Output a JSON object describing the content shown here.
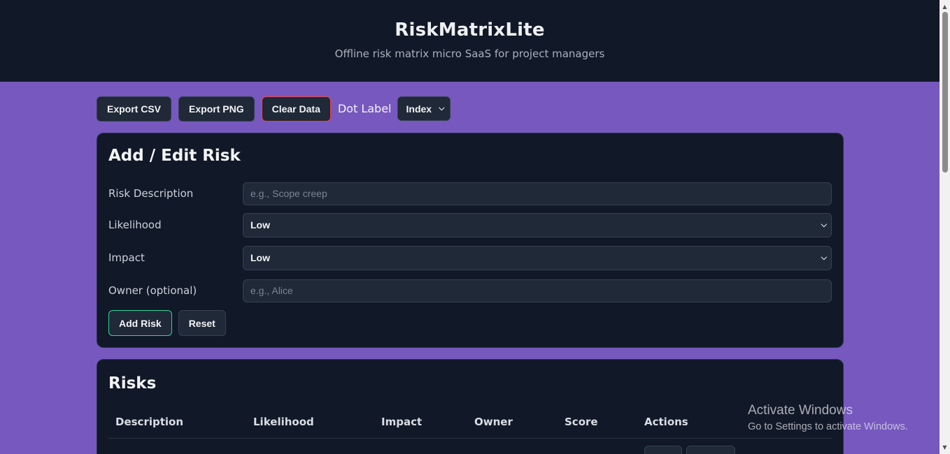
{
  "header": {
    "title": "RiskMatrixLite",
    "subtitle": "Offline risk matrix micro SaaS for project managers"
  },
  "toolbar": {
    "export_csv": "Export CSV",
    "export_png": "Export PNG",
    "clear_data": "Clear Data",
    "dot_label": "Dot Label",
    "dot_label_value": "Index"
  },
  "form": {
    "title": "Add / Edit Risk",
    "description_label": "Risk Description",
    "description_placeholder": "e.g., Scope creep",
    "likelihood_label": "Likelihood",
    "likelihood_value": "Low",
    "impact_label": "Impact",
    "impact_value": "Low",
    "owner_label": "Owner (optional)",
    "owner_placeholder": "e.g., Alice",
    "add_button": "Add Risk",
    "reset_button": "Reset"
  },
  "risks": {
    "title": "Risks",
    "columns": [
      "Description",
      "Likelihood",
      "Impact",
      "Owner",
      "Score",
      "Actions"
    ]
  },
  "watermark": {
    "line1": "Activate Windows",
    "line2": "Go to Settings to activate Windows."
  }
}
